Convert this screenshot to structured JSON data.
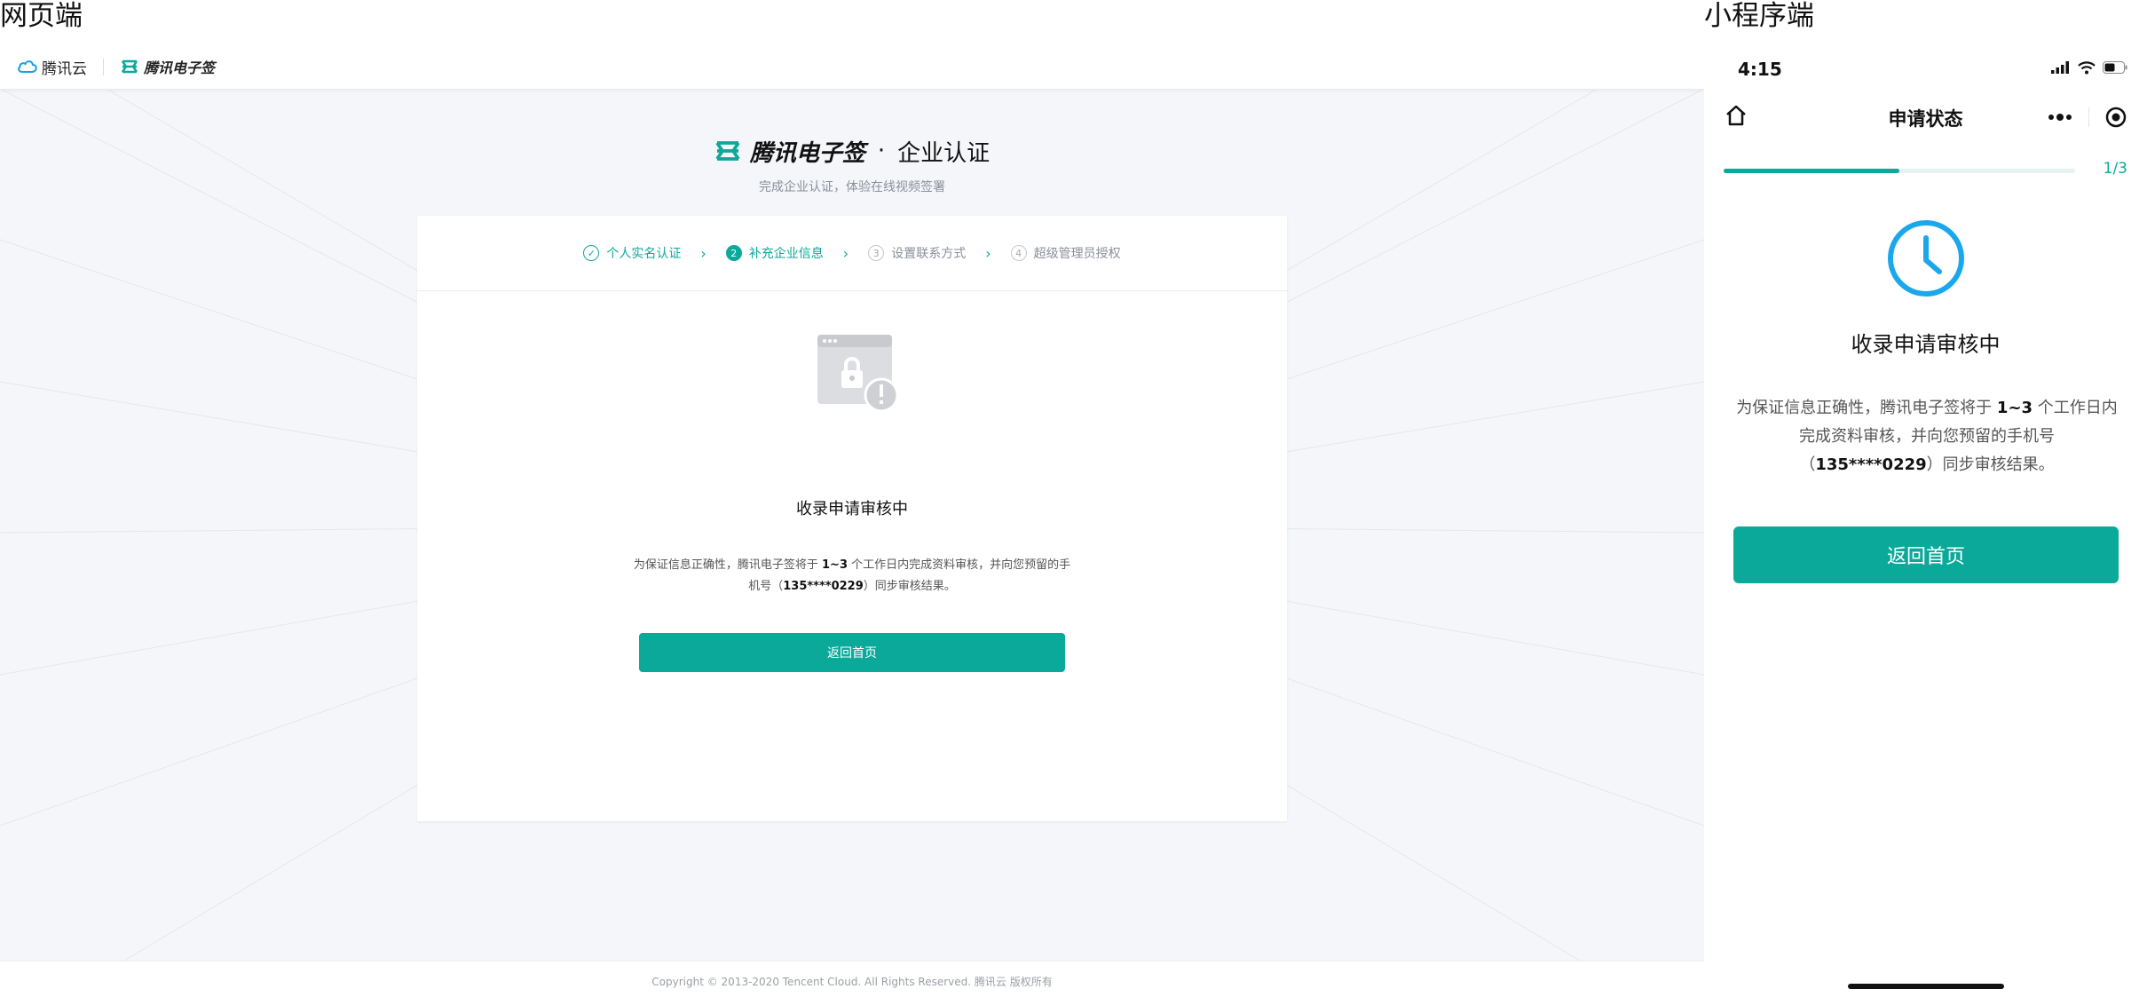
{
  "labels": {
    "web": "网页端",
    "mini": "小程序端"
  },
  "web": {
    "topbar": {
      "tencent_cloud": "腾讯云",
      "ess": "腾讯电子签"
    },
    "hero": {
      "brand": "腾讯电子签",
      "dot": "·",
      "title": "企业认证",
      "subtitle": "完成企业认证，体验在线视频签署"
    },
    "steps": [
      {
        "num": "✓",
        "label": "个人实名认证",
        "state": "done"
      },
      {
        "num": "2",
        "label": "补充企业信息",
        "state": "active"
      },
      {
        "num": "3",
        "label": "设置联系方式",
        "state": "todo"
      },
      {
        "num": "4",
        "label": "超级管理员授权",
        "state": "todo"
      }
    ],
    "status_title": "收录申请审核中",
    "desc": {
      "p1": "为保证信息正确性，腾讯电子签将于 ",
      "days": "1~3",
      "p2": " 个工作日内完成资料审核，并向您预留的手机号（",
      "phone": "135****0229",
      "p3": "）同步审核结果。"
    },
    "button": "返回首页",
    "footer": "Copyright © 2013-2020 Tencent Cloud. All Rights Reserved. 腾讯云 版权所有"
  },
  "mini": {
    "time": "4:15",
    "nav_title": "申请状态",
    "progress_text": "1/3",
    "progress_fraction": 0.5,
    "status_title": "收录申请审核中",
    "desc": {
      "p1": "为保证信息正确性，腾讯电子签将于 ",
      "days": "1~3",
      "p2": " 个工作日内完成资料审核，并向您预留的手机号（",
      "phone": "135****0229",
      "p3": "）同步审核结果。"
    },
    "button": "返回首页"
  },
  "colors": {
    "accent": "#0ba99a",
    "clock": "#1aa7ec"
  }
}
